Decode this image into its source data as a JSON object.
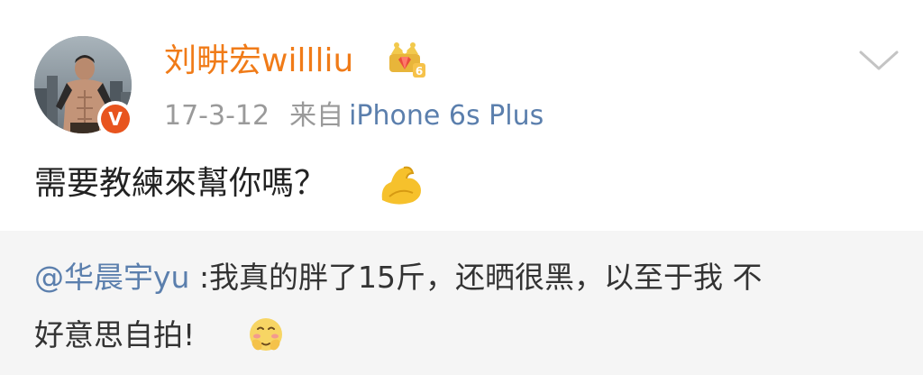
{
  "post": {
    "author": {
      "name": "刘畊宏willliu",
      "verified_mark": "V",
      "avatar_icon": "avatar-photo",
      "vip_icon": "crown-icon"
    },
    "meta": {
      "date": "17-3-12",
      "source_prefix": "来自",
      "device": "iPhone 6s Plus"
    },
    "more_icon": "chevron-down-icon",
    "text": "需要教練來幫你嗎？",
    "emoji": "flexed-biceps-icon"
  },
  "repost": {
    "mention": "@华晨宇yu",
    "text_line1": " :我真的胖了15斤，还晒很黑，以至于我 不",
    "text_line2": "好意思自拍!",
    "emoji": "awkward-face-icon"
  },
  "colors": {
    "username": "#f07b18",
    "link": "#5b7fad",
    "meta": "#9a9a9a",
    "repost_bg": "#f5f5f5",
    "verified": "#e8541e"
  }
}
